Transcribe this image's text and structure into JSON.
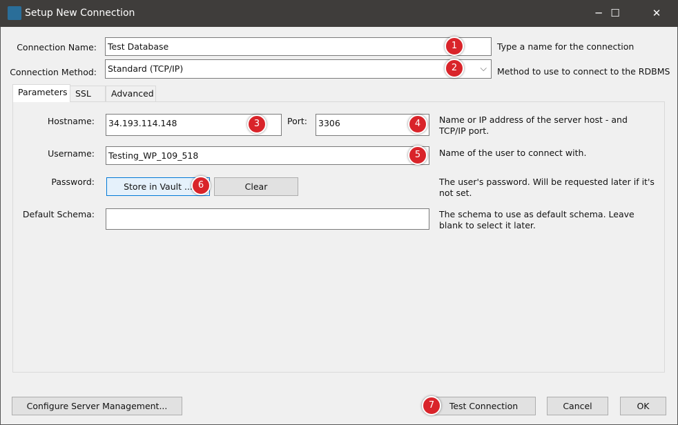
{
  "window": {
    "title": "Setup New Connection",
    "minimize": "─",
    "maximize": "☐",
    "close": "✕"
  },
  "connection_name": {
    "label": "Connection Name:",
    "value": "Test Database",
    "help": "Type a name for the connection"
  },
  "connection_method": {
    "label": "Connection Method:",
    "value": "Standard (TCP/IP)",
    "help": "Method to use to connect to the RDBMS"
  },
  "tabs": [
    {
      "label": "Parameters",
      "selected": true
    },
    {
      "label": "SSL"
    },
    {
      "label": "Advanced"
    }
  ],
  "params": {
    "hostname": {
      "label": "Hostname:",
      "value": "34.193.114.148"
    },
    "port": {
      "label": "Port:",
      "value": "3306"
    },
    "host_help": [
      "Name or IP address of the server host - and",
      "TCP/IP port."
    ],
    "username": {
      "label": "Username:",
      "value": "Testing_WP_109_518",
      "help": "Name of the user to connect with."
    },
    "password": {
      "label": "Password:",
      "store": "Store in Vault ...",
      "clear": "Clear",
      "help": [
        "The user's password. Will be requested later if it's",
        "not set."
      ]
    },
    "schema": {
      "label": "Default Schema:",
      "value": "",
      "help": [
        "The schema to use as default schema. Leave",
        "blank to select it later."
      ]
    }
  },
  "buttons": {
    "configure": "Configure Server Management...",
    "test": "Test Connection",
    "cancel": "Cancel",
    "ok": "OK"
  },
  "badges": [
    "1",
    "2",
    "3",
    "4",
    "5",
    "6",
    "7"
  ],
  "colors": {
    "badge": "#d9242a",
    "titlebar": "#3f3d3b",
    "focus_button": "#e5f1fb"
  }
}
